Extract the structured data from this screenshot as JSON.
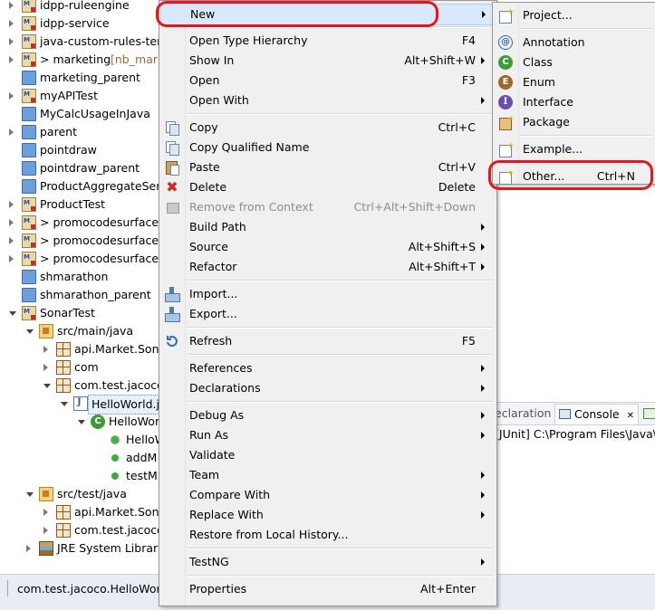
{
  "tree": [
    {
      "label": "idpp-ruleengine",
      "icon": "project-icon",
      "twisty": "collapsed",
      "indent": 0
    },
    {
      "label": "idpp-service",
      "icon": "project-icon",
      "twisty": "collapsed",
      "indent": 0
    },
    {
      "label": "java-custom-rules-tem",
      "icon": "project-icon",
      "twisty": "collapsed",
      "indent": 0
    },
    {
      "label": "> marketing",
      "decoration": "[nb_mark",
      "icon": "project-icon",
      "twisty": "collapsed",
      "indent": 0
    },
    {
      "label": "marketing_parent",
      "icon": "folder-icon",
      "twisty": "",
      "indent": 0
    },
    {
      "label": "myAPITest",
      "icon": "project-icon",
      "twisty": "collapsed",
      "indent": 0
    },
    {
      "label": "MyCalcUsageInJava",
      "icon": "folder-icon",
      "twisty": "",
      "indent": 0
    },
    {
      "label": "parent",
      "icon": "folder-icon",
      "twisty": "collapsed",
      "indent": 0
    },
    {
      "label": "pointdraw",
      "icon": "folder-icon",
      "twisty": "",
      "indent": 0
    },
    {
      "label": "pointdraw_parent",
      "icon": "folder-icon",
      "twisty": "",
      "indent": 0
    },
    {
      "label": "ProductAggregateServ",
      "icon": "folder-icon",
      "twisty": "",
      "indent": 0
    },
    {
      "label": "ProductTest",
      "icon": "project-icon",
      "twisty": "collapsed",
      "indent": 0
    },
    {
      "label": "> promocodesurface",
      "icon": "project-icon",
      "twisty": "collapsed",
      "indent": 0
    },
    {
      "label": "> promocodesurface-",
      "icon": "project-icon",
      "twisty": "collapsed",
      "indent": 0
    },
    {
      "label": "> promocodesurface-",
      "icon": "project-icon",
      "twisty": "collapsed",
      "indent": 0
    },
    {
      "label": "shmarathon",
      "icon": "folder-icon",
      "twisty": "",
      "indent": 0
    },
    {
      "label": "shmarathon_parent",
      "icon": "folder-icon",
      "twisty": "",
      "indent": 0
    },
    {
      "label": "SonarTest",
      "icon": "project-icon",
      "twisty": "expanded",
      "indent": 0
    },
    {
      "label": "src/main/java",
      "icon": "source-folder-icon",
      "twisty": "expanded",
      "indent": 1
    },
    {
      "label": "api.Market.Sona",
      "icon": "package-icon",
      "twisty": "collapsed",
      "indent": 2
    },
    {
      "label": "com",
      "icon": "package-icon",
      "twisty": "collapsed",
      "indent": 2
    },
    {
      "label": "com.test.jacoco",
      "icon": "package-icon",
      "twisty": "expanded",
      "indent": 2
    },
    {
      "label": "HelloWorld.j",
      "icon": "java-file-icon",
      "twisty": "expanded",
      "indent": 3,
      "selected": true
    },
    {
      "label": "HelloWorld",
      "icon": "class-icon",
      "twisty": "expanded",
      "indent": 4
    },
    {
      "label": "HelloW",
      "icon": "constructor-icon",
      "twisty": "",
      "indent": 5
    },
    {
      "label": "addM",
      "icon": "method-icon",
      "twisty": "",
      "indent": 5
    },
    {
      "label": "testM",
      "icon": "method-icon",
      "twisty": "",
      "indent": 5
    },
    {
      "label": "src/test/java",
      "icon": "source-folder-icon",
      "twisty": "expanded",
      "indent": 1
    },
    {
      "label": "api.Market.Sona",
      "icon": "package-icon",
      "twisty": "collapsed",
      "indent": 2
    },
    {
      "label": "com.test.jacoco",
      "icon": "package-icon",
      "twisty": "collapsed",
      "indent": 2
    },
    {
      "label": "JRE System Library",
      "icon": "library-icon",
      "twisty": "collapsed",
      "indent": 1
    }
  ],
  "status": {
    "text": "com.test.jacoco.HelloWorld"
  },
  "console": {
    "partial_tab": "eclaration",
    "tab": "Console",
    "close": "✕",
    "text": "[JUnit] C:\\Program Files\\Java\\"
  },
  "context_menu": [
    {
      "label": "New",
      "shortcut": "",
      "submenu": true,
      "icon": "",
      "highlight": true
    },
    {
      "sep": true
    },
    {
      "label": "Open Type Hierarchy",
      "shortcut": "F4"
    },
    {
      "label": "Show In",
      "shortcut": "Alt+Shift+W",
      "submenu": true
    },
    {
      "label": "Open",
      "shortcut": "F3"
    },
    {
      "label": "Open With",
      "shortcut": "",
      "submenu": true
    },
    {
      "sep": true
    },
    {
      "label": "Copy",
      "shortcut": "Ctrl+C",
      "icon": "copy-icon"
    },
    {
      "label": "Copy Qualified Name",
      "shortcut": "",
      "icon": "copy-qualified-icon"
    },
    {
      "label": "Paste",
      "shortcut": "Ctrl+V",
      "icon": "paste-icon"
    },
    {
      "label": "Delete",
      "shortcut": "Delete",
      "icon": "delete-icon"
    },
    {
      "label": "Remove from Context",
      "shortcut": "Ctrl+Alt+Shift+Down",
      "icon": "remove-context-icon",
      "disabled": true
    },
    {
      "label": "Build Path",
      "shortcut": "",
      "submenu": true
    },
    {
      "label": "Source",
      "shortcut": "Alt+Shift+S",
      "submenu": true
    },
    {
      "label": "Refactor",
      "shortcut": "Alt+Shift+T",
      "submenu": true
    },
    {
      "sep": true
    },
    {
      "label": "Import...",
      "shortcut": "",
      "icon": "import-icon"
    },
    {
      "label": "Export...",
      "shortcut": "",
      "icon": "export-icon"
    },
    {
      "sep": true
    },
    {
      "label": "Refresh",
      "shortcut": "F5",
      "icon": "refresh-icon"
    },
    {
      "sep": true
    },
    {
      "label": "References",
      "shortcut": "",
      "submenu": true
    },
    {
      "label": "Declarations",
      "shortcut": "",
      "submenu": true
    },
    {
      "sep": true
    },
    {
      "label": "Debug As",
      "shortcut": "",
      "submenu": true
    },
    {
      "label": "Run As",
      "shortcut": "",
      "submenu": true
    },
    {
      "label": "Validate",
      "shortcut": ""
    },
    {
      "label": "Team",
      "shortcut": "",
      "submenu": true
    },
    {
      "label": "Compare With",
      "shortcut": "",
      "submenu": true
    },
    {
      "label": "Replace With",
      "shortcut": "",
      "submenu": true
    },
    {
      "label": "Restore from Local History...",
      "shortcut": ""
    },
    {
      "sep": true
    },
    {
      "label": "TestNG",
      "shortcut": "",
      "submenu": true
    },
    {
      "sep": true
    },
    {
      "label": "Properties",
      "shortcut": "Alt+Enter"
    }
  ],
  "new_submenu": [
    {
      "label": "Project...",
      "shortcut": "",
      "icon": "new-project-icon"
    },
    {
      "sep": true
    },
    {
      "label": "Annotation",
      "shortcut": "",
      "icon": "annotation-icon"
    },
    {
      "label": "Class",
      "shortcut": "",
      "icon": "new-class-icon"
    },
    {
      "label": "Enum",
      "shortcut": "",
      "icon": "enum-icon"
    },
    {
      "label": "Interface",
      "shortcut": "",
      "icon": "interface-icon"
    },
    {
      "label": "Package",
      "shortcut": "",
      "icon": "new-package-icon"
    },
    {
      "sep": true
    },
    {
      "label": "Example...",
      "shortcut": "",
      "icon": "example-icon"
    },
    {
      "sep": true
    },
    {
      "label": "Other...",
      "shortcut": "Ctrl+N",
      "icon": "other-icon"
    }
  ],
  "colors": {
    "highlight_ring": "#e0191c",
    "menu_bg": "#f0f0f0",
    "selection": "#d9e8fb"
  }
}
